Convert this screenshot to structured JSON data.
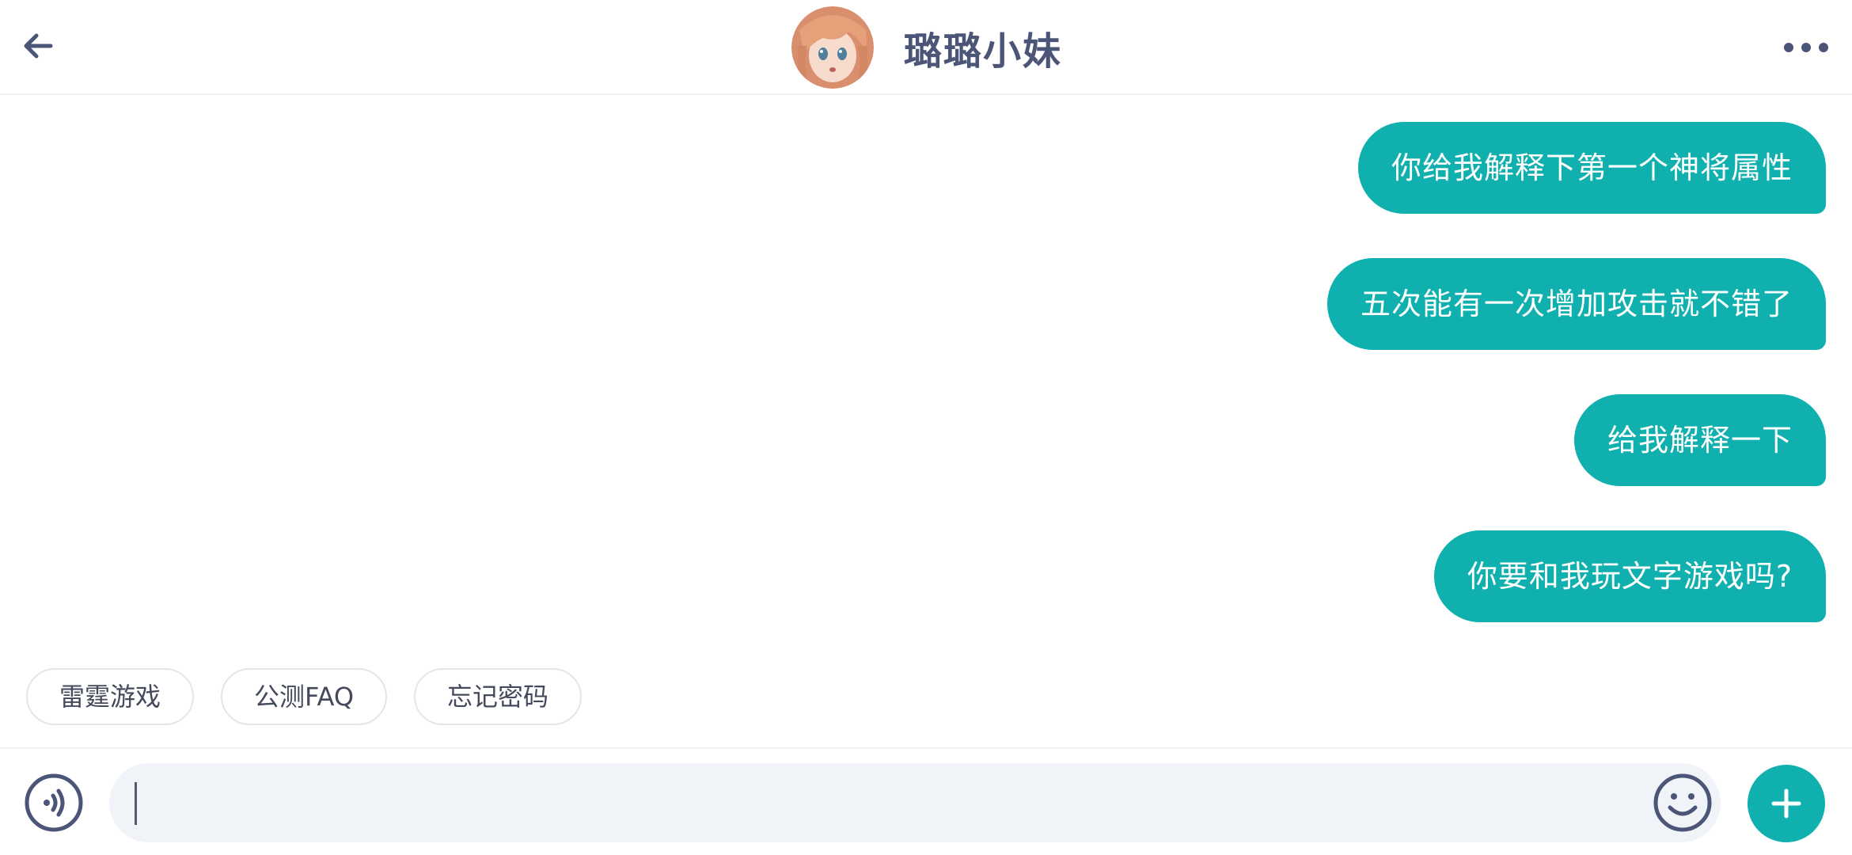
{
  "header": {
    "back_icon": "arrow-left-icon",
    "title": "璐璐小妹",
    "avatar": "anime-girl-avatar",
    "more_icon": "more-horizontal-icon"
  },
  "messages": [
    {
      "sender": "me",
      "text": "你给我解释下第一个神将属性"
    },
    {
      "sender": "me",
      "text": "五次能有一次增加攻击就不错了"
    },
    {
      "sender": "me",
      "text": "给我解释一下"
    },
    {
      "sender": "me",
      "text": "你要和我玩文字游戏吗?"
    }
  ],
  "quick_replies": [
    "雷霆游戏",
    "公测FAQ",
    "忘记密码"
  ],
  "input_bar": {
    "voice_icon": "voice-icon",
    "text_value": "",
    "emoji_icon": "smiley-icon",
    "plus_icon": "plus-icon"
  },
  "colors": {
    "accent": "#10b0ae",
    "header_text": "#4b5577",
    "input_bg": "#f0f3f7",
    "chip_border": "#e3e6eb"
  }
}
